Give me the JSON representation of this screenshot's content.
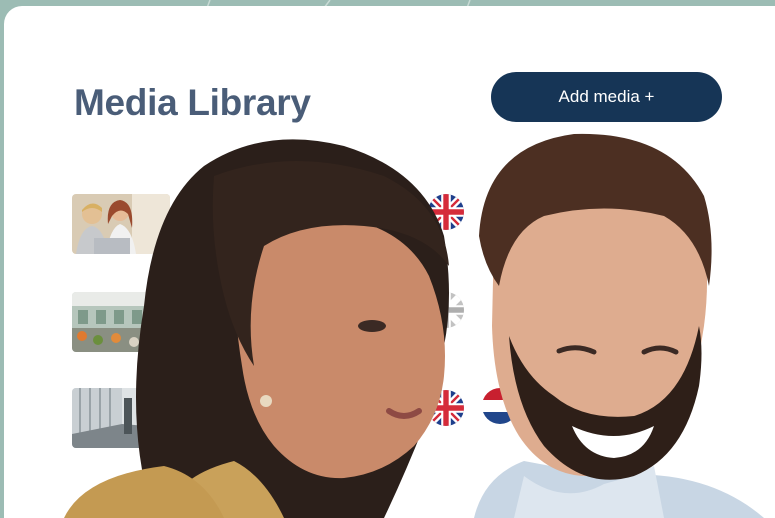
{
  "header": {
    "title": "Media Library",
    "add_button_label": "Add media +"
  },
  "media_items": [
    {
      "thumbnail": "two-people-laptop",
      "flag": "uk-flag-icon"
    },
    {
      "thumbnail": "office-space",
      "flag": "uk-flag-icon"
    },
    {
      "thumbnail": "glass-corridor",
      "flag": "uk-flag-icon",
      "flag_secondary": "netherlands-flag-icon"
    }
  ],
  "colors": {
    "page_bg": "#9cbcb4",
    "card_bg": "#ffffff",
    "title": "#4a5d78",
    "button_bg": "#163556",
    "button_text": "#ffffff"
  }
}
